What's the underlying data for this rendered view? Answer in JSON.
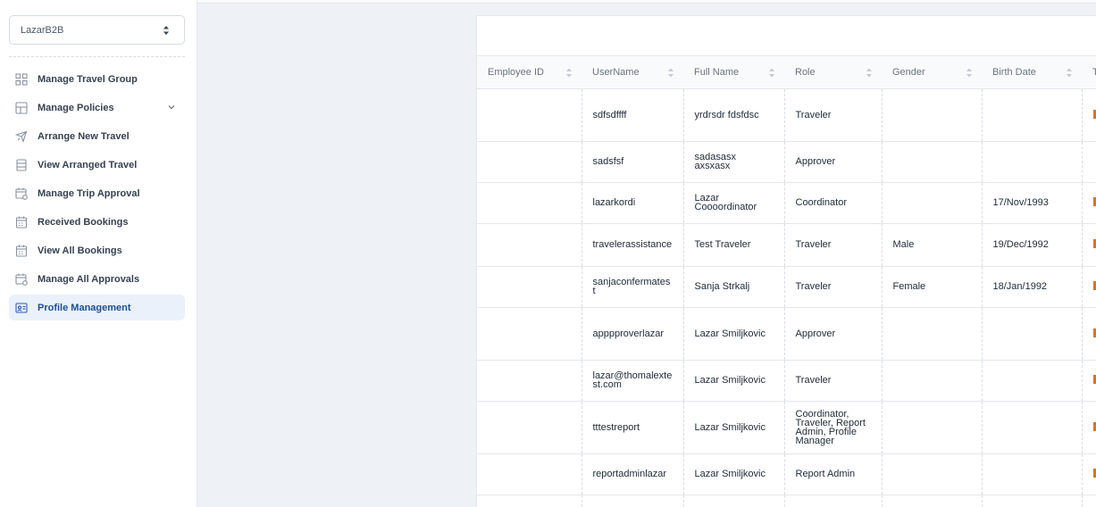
{
  "sidebar": {
    "company": "LazarB2B",
    "items": [
      {
        "label": "Manage Travel Group",
        "icon": "grid-icon"
      },
      {
        "label": "Manage Policies",
        "icon": "table-icon"
      },
      {
        "label": "Arrange New Travel",
        "icon": "plane-icon"
      },
      {
        "label": "View Arranged Travel",
        "icon": "list-icon"
      },
      {
        "label": "Manage Trip Approval",
        "icon": "calendar-check-icon"
      },
      {
        "label": "Received Bookings",
        "icon": "calendar-icon"
      },
      {
        "label": "View All Bookings",
        "icon": "calendar-icon"
      },
      {
        "label": "Manage All Approvals",
        "icon": "calendar-check-icon"
      },
      {
        "label": "Profile Management",
        "icon": "id-card-icon"
      }
    ]
  },
  "table": {
    "headers": [
      "Employee ID",
      "UserName",
      "Full Name",
      "Role",
      "Gender",
      "Birth Date",
      "T"
    ],
    "rows": [
      {
        "employee_id": "",
        "username": "sdfsdffff",
        "full_name": "yrdrsdr fdsfdsc",
        "role": "Traveler",
        "gender": "",
        "birth_date": ""
      },
      {
        "employee_id": "",
        "username": "sadsfsf",
        "full_name": "sadasasx axsxasx",
        "role": "Approver",
        "gender": "",
        "birth_date": ""
      },
      {
        "employee_id": "",
        "username": "lazarkordi",
        "full_name": "Lazar Coooordinator",
        "role": "Coordinator",
        "gender": "",
        "birth_date": "17/Nov/1993"
      },
      {
        "employee_id": "",
        "username": "travelerassistance",
        "full_name": "Test Traveler",
        "role": "Traveler",
        "gender": "Male",
        "birth_date": "19/Dec/1992"
      },
      {
        "employee_id": "",
        "username": "sanjaconfermatest",
        "full_name": "Sanja Strkalj",
        "role": "Traveler",
        "gender": "Female",
        "birth_date": "18/Jan/1992"
      },
      {
        "employee_id": "",
        "username": "apppproverlazar",
        "full_name": "Lazar Smiljkovic",
        "role": "Approver",
        "gender": "",
        "birth_date": ""
      },
      {
        "employee_id": "",
        "username": "lazar@thomalextest.com",
        "full_name": "Lazar Smiljkovic",
        "role": "Traveler",
        "gender": "",
        "birth_date": ""
      },
      {
        "employee_id": "",
        "username": "tttestreport",
        "full_name": "Lazar Smiljkovic",
        "role": "Coordinator, Traveler, Report Admin, Profile Manager",
        "gender": "",
        "birth_date": ""
      },
      {
        "employee_id": "",
        "username": "reportadminlazar",
        "full_name": "Lazar Smiljkovic",
        "role": "Report Admin",
        "gender": "",
        "birth_date": ""
      },
      {
        "employee_id": "",
        "username": "",
        "full_name": "",
        "role": "",
        "gender": "",
        "birth_date": ""
      }
    ]
  }
}
